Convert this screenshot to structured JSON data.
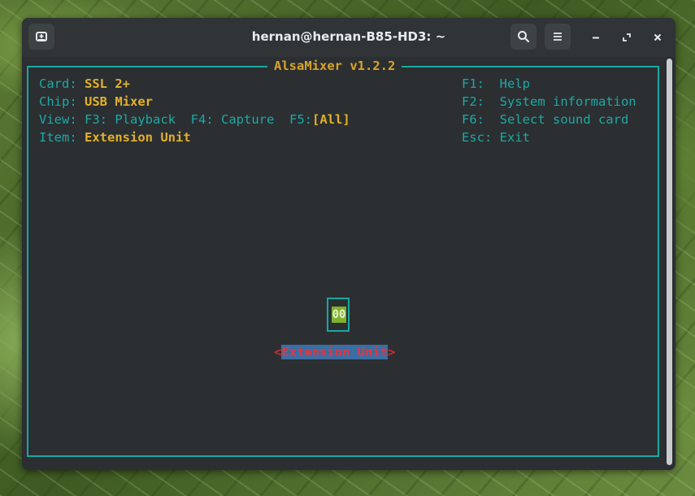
{
  "window": {
    "title": "hernan@hernan-B85-HD3: ~",
    "buttons": {
      "new_tab": "new-tab-icon",
      "search": "search-icon",
      "menu": "hamburger-menu-icon",
      "minimize": "minimize-icon",
      "maximize": "maximize-icon",
      "close": "close-icon"
    }
  },
  "mixer": {
    "title": "AlsaMixer v1.2.2",
    "card_label": "Card:",
    "card_value": "SSL 2+",
    "chip_label": "Chip:",
    "chip_value": "USB Mixer",
    "view_label": "View:",
    "view_playback": "F3: Playback",
    "view_capture": "F4: Capture",
    "view_all_key": "F5:",
    "view_all": "[All]",
    "item_label": "Item:",
    "item_value": "Extension Unit",
    "help": [
      {
        "key": "F1:",
        "text": "Help"
      },
      {
        "key": "F2:",
        "text": "System information"
      },
      {
        "key": "F6:",
        "text": "Select sound card"
      },
      {
        "key": "Esc:",
        "text": "Exit"
      }
    ],
    "control_value": "00",
    "control_left_bracket": "<",
    "control_name": "Extension Unit",
    "control_right_bracket": ">"
  },
  "colors": {
    "accent_teal": "#1aa7a3",
    "highlight_gold": "#e3b02c",
    "selection_blue": "#3a6ea5",
    "label_red": "#e7343a",
    "meter_green": "#7fb22d"
  }
}
